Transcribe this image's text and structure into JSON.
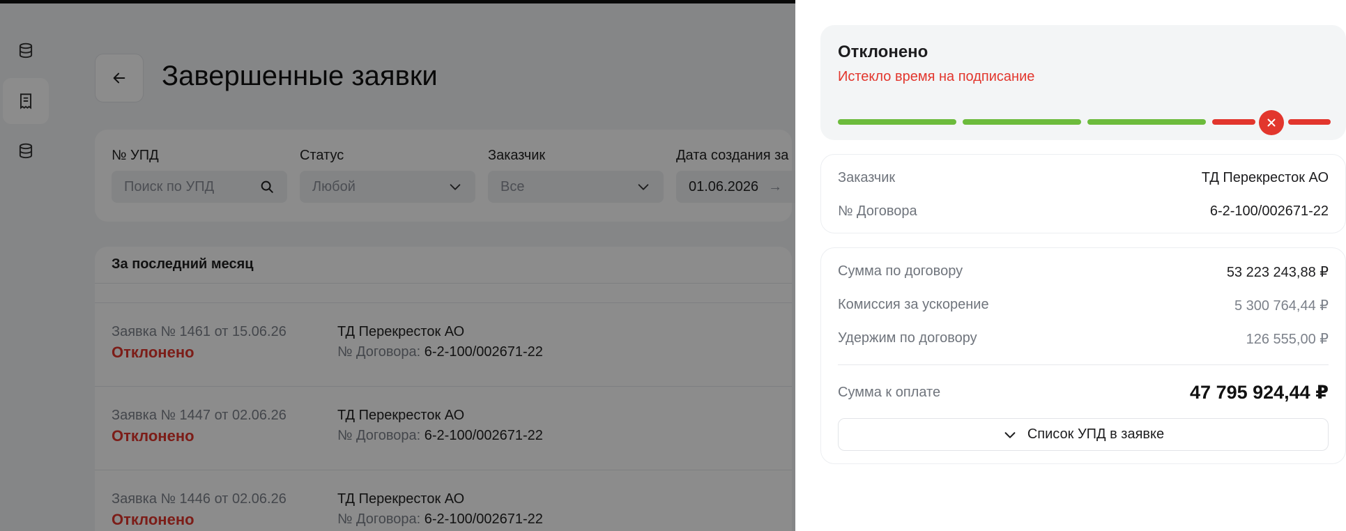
{
  "page": {
    "title": "Завершенные заявки",
    "back_icon": "arrow-left-icon"
  },
  "rail": {
    "items": [
      {
        "icon": "database-icon",
        "active": false
      },
      {
        "icon": "document-icon",
        "active": true
      },
      {
        "icon": "database-icon",
        "active": false
      }
    ]
  },
  "filters": {
    "upd": {
      "label": "№ УПД",
      "placeholder": "Поиск по УПД"
    },
    "status": {
      "label": "Статус",
      "value": "Любой"
    },
    "client": {
      "label": "Заказчик",
      "value": "Все"
    },
    "date": {
      "label": "Дата создания за",
      "value": "01.06.2026",
      "arrow": "→"
    }
  },
  "list": {
    "header": "За последний месяц",
    "contract_prefix": "№ Договора: ",
    "rows": [
      {
        "app": "Заявка № 1461 от 15.06.26",
        "status": "Отклонено",
        "client": "ТД Перекресток АО",
        "contract": "6-2-100/002671-22"
      },
      {
        "app": "Заявка № 1447 от 02.06.26",
        "status": "Отклонено",
        "client": "ТД Перекресток АО",
        "contract": "6-2-100/002671-22"
      },
      {
        "app": "Заявка № 1446 от 02.06.26",
        "status": "Отклонено",
        "client": "ТД Перекресток АО",
        "contract": "6-2-100/002671-22"
      }
    ]
  },
  "panel": {
    "status": {
      "title": "Отклонено",
      "subtitle": "Истекло время на подписание",
      "steps_done": 3,
      "steps_total": 4,
      "failed_step": 4
    },
    "info": {
      "client_label": "Заказчик",
      "client_value": "ТД Перекресток АО",
      "contract_label": "№ Договора",
      "contract_value": "6-2-100/002671-22"
    },
    "sums": {
      "contract_sum_label": "Сумма по договору",
      "contract_sum_value": "53 223 243,88 ₽",
      "commission_label": "Комиссия за ускорение",
      "commission_value": "5 300 764,44 ₽",
      "withhold_label": "Удержим по договору",
      "withhold_value": "126 555,00 ₽",
      "total_label": "Сумма к оплате",
      "total_value": "47 795 924,44 ₽",
      "list_button": "Список УПД в заявке"
    }
  },
  "colors": {
    "success": "#6cbb3c",
    "error": "#e2362d",
    "overlay": "rgba(0,0,0,0.45)"
  }
}
